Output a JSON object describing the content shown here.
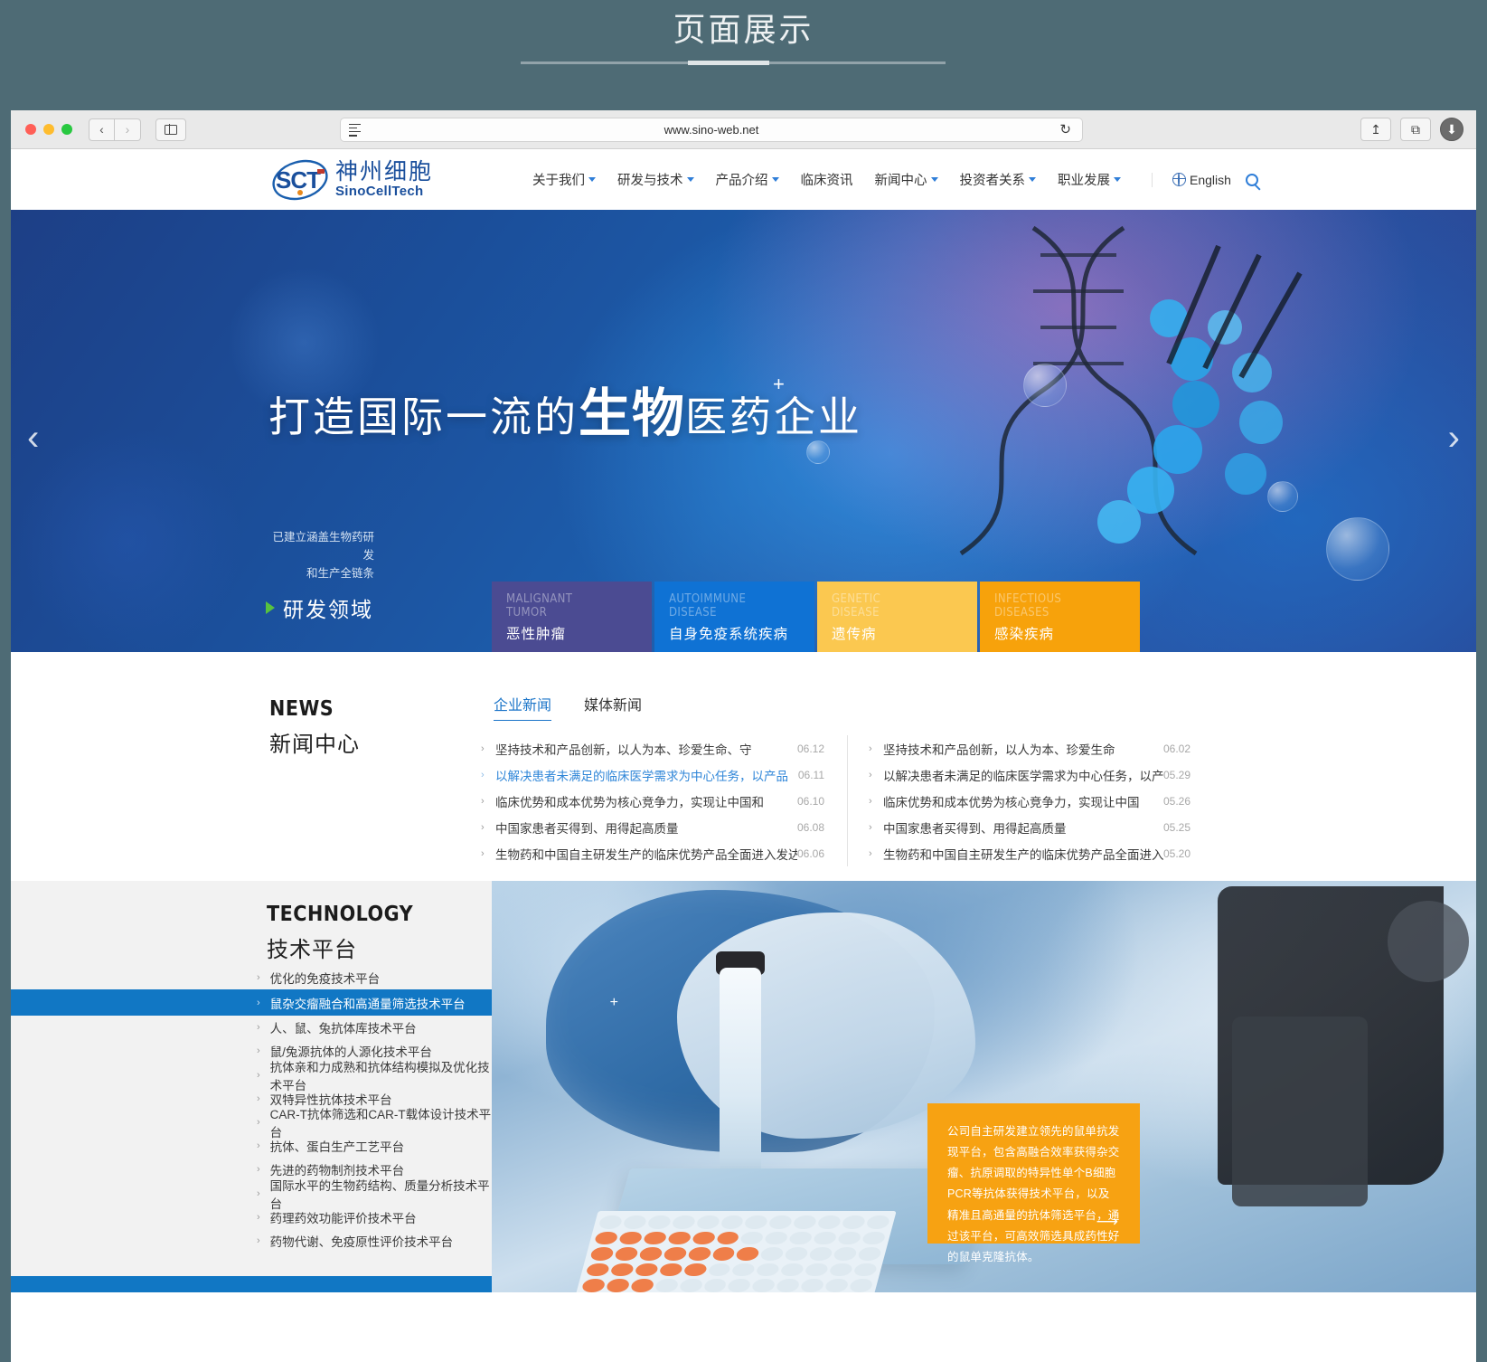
{
  "page": {
    "title": "页面展示"
  },
  "browser": {
    "url": "www.sino-web.net",
    "back_icon": "‹",
    "forward_icon": "›",
    "sidebar_icon": "sidebar-icon",
    "reload_icon": "↻",
    "share_icon": "↥",
    "tabs_icon": "⧉",
    "download_icon": "⬇"
  },
  "site": {
    "logo": {
      "mark": "SCT",
      "cn": "神州细胞",
      "en": "SinoCellTech"
    },
    "menu": [
      {
        "label": "关于我们",
        "has_caret": true
      },
      {
        "label": "研发与技术",
        "has_caret": true
      },
      {
        "label": "产品介绍",
        "has_caret": true
      },
      {
        "label": "临床资讯",
        "has_caret": false
      },
      {
        "label": "新闻中心",
        "has_caret": true
      },
      {
        "label": "投资者关系",
        "has_caret": true
      },
      {
        "label": "职业发展",
        "has_caret": true
      }
    ],
    "language": "English",
    "search_icon": "search-icon",
    "globe_icon": "globe-icon"
  },
  "hero": {
    "title_plain_1": "打造国际一流的",
    "title_brush": "生物",
    "title_plain_2": "医药企业",
    "superscript": "+",
    "prev_arrow": "‹",
    "next_arrow": "›",
    "note_line1": "已建立涵盖生物药研发",
    "note_line2": "和生产全链条",
    "field_label": "研发领域",
    "cards": [
      {
        "en_line1": "MALIGNANT",
        "en_line2": "TUMOR",
        "cn": "恶性肿瘤",
        "color": "#4b4b92"
      },
      {
        "en_line1": "AUTOIMMUNE",
        "en_line2": "DISEASE",
        "cn": "自身免疫系统疾病",
        "color": "#0f72d4"
      },
      {
        "en_line1": "GENETIC",
        "en_line2": "DISEASE",
        "cn": "遗传病",
        "color": "#fbc850"
      },
      {
        "en_line1": "INFECTIOUS",
        "en_line2": "DISEASES",
        "cn": "感染疾病",
        "color": "#f7a20b"
      }
    ]
  },
  "news": {
    "heading_en": "NEWS",
    "heading_cn": "新闻中心",
    "tabs": [
      {
        "label": "企业新闻",
        "active": true
      },
      {
        "label": "媒体新闻",
        "active": false
      }
    ],
    "left_items": [
      {
        "title": "坚持技术和产品创新，以人为本、珍爱生命、守",
        "date": "06.12",
        "highlight": false
      },
      {
        "title": "以解决患者未满足的临床医学需求为中心任务，以产品",
        "date": "06.11",
        "highlight": true
      },
      {
        "title": "临床优势和成本优势为核心竞争力，实现让中国和",
        "date": "06.10",
        "highlight": false
      },
      {
        "title": "中国家患者买得到、用得起高质量",
        "date": "06.08",
        "highlight": false
      },
      {
        "title": "生物药和中国自主研发生产的临床优势产品全面进入发达国",
        "date": "06.06",
        "highlight": false
      }
    ],
    "right_items": [
      {
        "title": "坚持技术和产品创新，以人为本、珍爱生命",
        "date": "06.02",
        "highlight": false
      },
      {
        "title": "以解决患者未满足的临床医学需求为中心任务，以产",
        "date": "05.29",
        "highlight": false
      },
      {
        "title": "临床优势和成本优势为核心竞争力，实现让中国",
        "date": "05.26",
        "highlight": false
      },
      {
        "title": "中国家患者买得到、用得起高质量",
        "date": "05.25",
        "highlight": false
      },
      {
        "title": "生物药和中国自主研发生产的临床优势产品全面进入发",
        "date": "05.20",
        "highlight": false
      }
    ]
  },
  "technology": {
    "heading_en": "TECHNOLOGY",
    "heading_cn": "技术平台",
    "items": [
      {
        "label": "优化的免疫技术平台",
        "active": false
      },
      {
        "label": "鼠杂交瘤融合和高通量筛选技术平台",
        "active": true
      },
      {
        "label": "人、鼠、兔抗体库技术平台",
        "active": false
      },
      {
        "label": "鼠/兔源抗体的人源化技术平台",
        "active": false
      },
      {
        "label": "抗体亲和力成熟和抗体结构模拟及优化技术平台",
        "active": false
      },
      {
        "label": "双特异性抗体技术平台",
        "active": false
      },
      {
        "label": "CAR-T抗体筛选和CAR-T载体设计技术平台",
        "active": false
      },
      {
        "label": "抗体、蛋白生产工艺平台",
        "active": false
      },
      {
        "label": "先进的药物制剂技术平台",
        "active": false
      },
      {
        "label": "国际水平的生物药结构、质量分析技术平台",
        "active": false
      },
      {
        "label": "药理药效功能评价技术平台",
        "active": false
      },
      {
        "label": "药物代谢、免疫原性评价技术平台",
        "active": false
      }
    ],
    "active_plus": "+",
    "callout_text": "公司自主研发建立领先的鼠单抗发现平台，包含高融合效率获得杂交瘤、抗原调取的特异性单个B细胞PCR等抗体获得技术平台，以及精准且高通量的抗体筛选平台，通过该平台，可高效筛选具成药性好的鼠单克隆抗体。",
    "callout_arrow": "⟶",
    "callout_color": "#f7a212"
  }
}
